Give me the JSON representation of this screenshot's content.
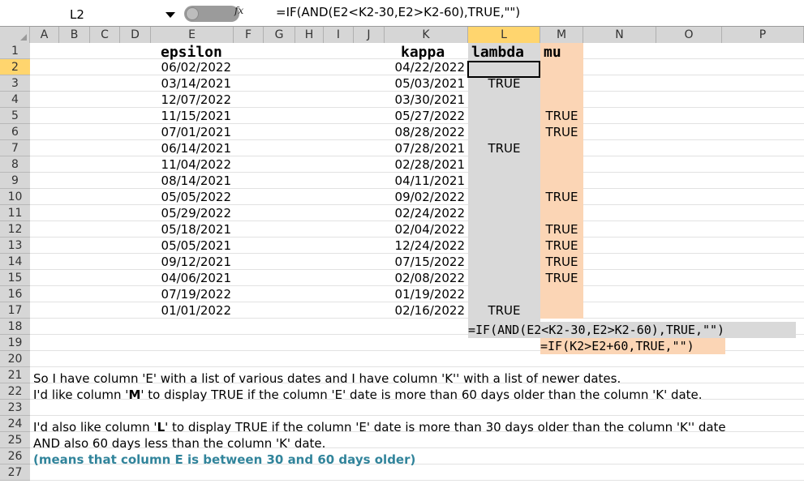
{
  "formula_bar": {
    "namebox": "L2",
    "fx_icon": "fx",
    "formula": "=IF(AND(E2<K2-30,E2>K2-60),TRUE,\"\")"
  },
  "columns": [
    "A",
    "B",
    "C",
    "D",
    "E",
    "F",
    "G",
    "H",
    "I",
    "J",
    "K",
    "L",
    "M",
    "N",
    "O",
    "P"
  ],
  "rows": [
    "1",
    "2",
    "3",
    "4",
    "5",
    "6",
    "7",
    "8",
    "9",
    "10",
    "11",
    "12",
    "13",
    "14",
    "15",
    "16",
    "17",
    "18",
    "19",
    "20",
    "21",
    "22",
    "23",
    "24",
    "25",
    "26",
    "27"
  ],
  "headers": {
    "E": "epsilon",
    "K": "kappa",
    "L": "lambda",
    "M": "mu"
  },
  "col_e": [
    "06/02/2022",
    "03/14/2021",
    "12/07/2022",
    "11/15/2021",
    "07/01/2021",
    "06/14/2021",
    "11/04/2022",
    "08/14/2021",
    "05/05/2022",
    "05/29/2022",
    "05/18/2021",
    "05/05/2021",
    "09/12/2021",
    "04/06/2021",
    "07/19/2022",
    "01/01/2022"
  ],
  "col_k": [
    "04/22/2022",
    "05/03/2021",
    "03/30/2021",
    "05/27/2022",
    "08/28/2022",
    "07/28/2021",
    "02/28/2021",
    "04/11/2021",
    "09/02/2022",
    "02/24/2022",
    "02/04/2022",
    "12/24/2022",
    "07/15/2022",
    "02/08/2022",
    "01/19/2022",
    "02/16/2022"
  ],
  "col_l": [
    "",
    "TRUE",
    "",
    "",
    "",
    "TRUE",
    "",
    "",
    "",
    "",
    "",
    "",
    "",
    "",
    "",
    "TRUE"
  ],
  "col_m": [
    "",
    "",
    "",
    "TRUE",
    "TRUE",
    "",
    "",
    "",
    "TRUE",
    "",
    "TRUE",
    "TRUE",
    "TRUE",
    "TRUE",
    "",
    ""
  ],
  "formula_l": "=IF(AND(E2<K2-30,E2>K2-60),TRUE,\"\")",
  "formula_m": "=IF(K2>E2+60,TRUE,\"\")",
  "notes": {
    "r21": "So I have column 'E' with a list of various dates and I have column 'K'' with a list of newer dates.",
    "r22_a": "I'd like column '",
    "r22_b": "M",
    "r22_c": "' to display TRUE if the column 'E' date is more than 60 days older than the column 'K' date.",
    "r24_a": "I'd also like column '",
    "r24_b": "L",
    "r24_c": "' to display TRUE if the column 'E' date is more than 30 days older than the column 'K'' date",
    "r25": " AND also 60 days less than the column 'K' date.",
    "r26": "(means that column E is between 30 and 60 days older)"
  },
  "colors": {
    "lambda_fill": "#d9d9d9",
    "mu_fill": "#fbd5b5",
    "note_teal": "#31849b",
    "selected_header": "#ffd56e"
  }
}
